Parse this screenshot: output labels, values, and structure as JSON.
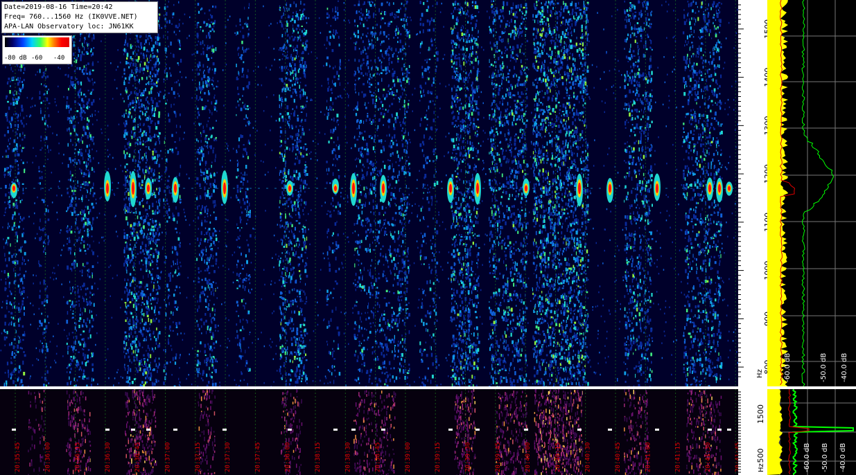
{
  "chart_data": {
    "type": "heatmap",
    "header_lines": [
      "Date=2019-08-16 Time=20:42",
      "Freq= 760...1560 Hz (IK0VVE.NET)",
      "APA-LAN Observatory loc: JN61KK"
    ],
    "colorbar": {
      "labels": [
        "-80 dB",
        "-60",
        "-40"
      ]
    },
    "freq_range_hz": [
      760,
      1560
    ],
    "freq_ticks": [
      "1500",
      "1400",
      "1300",
      "1200",
      "1100",
      "1000",
      "900",
      "800"
    ],
    "freq_unit": "Hz",
    "sub_freq_ticks": [
      "1500",
      "500"
    ],
    "sub_freq_unit": "Hz",
    "time_ticks": [
      "20:35:45",
      "20:36:00",
      "20:36:15",
      "20:36:30",
      "20:36:45",
      "20:37:00",
      "20:37:15",
      "20:37:30",
      "20:37:45",
      "20:38:00",
      "20:38:15",
      "20:38:30",
      "20:38:45",
      "20:39:00",
      "20:39:15",
      "20:39:30",
      "20:39:45",
      "20:40:00",
      "20:40:15",
      "20:40:30",
      "20:40:45",
      "20:41:00",
      "20:41:15",
      "20:41:30",
      "20:41:45"
    ],
    "spectrum_db_labels": [
      "-60.0 dB",
      "-50.0 dB",
      "-40.0 dB"
    ],
    "spectrum_sub_db_labels": [
      "-60.0 dB",
      "-50.0 dB",
      "-40.0 dB"
    ],
    "carrier_freq_hz": 1170,
    "grid": true
  },
  "colors": {
    "grid": "#1f8f1f",
    "time_labels": "#e00000",
    "spectrum_peak": "#00ff00",
    "spectrum_fill": "#ffff00",
    "spectrum_avg": "#e00000"
  }
}
